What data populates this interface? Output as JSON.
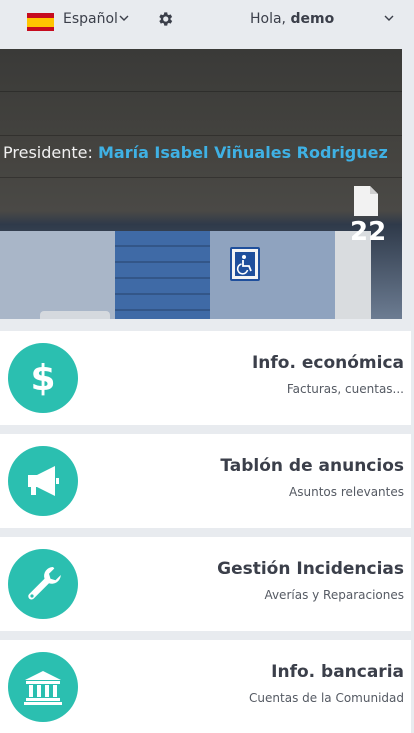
{
  "header": {
    "language": "Español",
    "greeting_prefix": "Hola,",
    "user_name": "demo"
  },
  "hero": {
    "president_label": "Presidente:",
    "president_name": "María Isabel Viñuales Rodriguez",
    "document_count": "22"
  },
  "menu": [
    {
      "title": "Info. económica",
      "subtitle": "Facturas, cuentas..."
    },
    {
      "title": "Tablón de anuncios",
      "subtitle": "Asuntos relevantes"
    },
    {
      "title": "Gestión Incidencias",
      "subtitle": "Averías y Reparaciones"
    },
    {
      "title": "Info. bancaria",
      "subtitle": "Cuentas de la Comunidad"
    }
  ],
  "colors": {
    "accent": "#2bbfb0",
    "president_name": "#3fb1e4",
    "background": "#e8ebef"
  },
  "icons": {
    "language_flag": "spain-flag-icon",
    "settings": "gear-icon",
    "documents": "document-icon",
    "menu_0": "dollar-icon",
    "menu_1": "megaphone-icon",
    "menu_2": "wrench-icon",
    "menu_3": "bank-icon"
  }
}
